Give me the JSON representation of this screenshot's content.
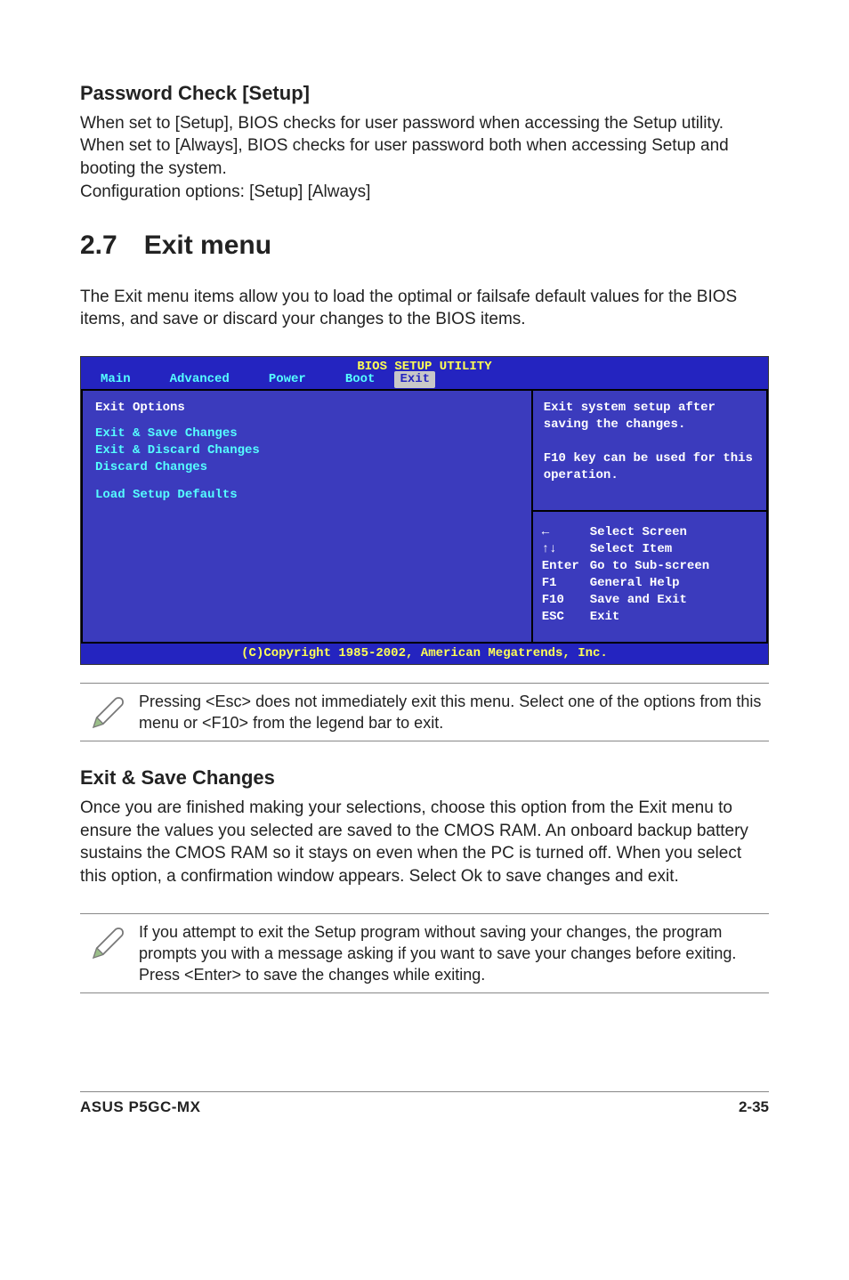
{
  "password_check": {
    "heading": "Password Check [Setup]",
    "body": "When set to [Setup], BIOS checks for user password when accessing the Setup utility. When set to [Always], BIOS checks for user password both when accessing Setup and booting the system.\nConfiguration options: [Setup] [Always]"
  },
  "section": {
    "num_title": "2.7 Exit menu",
    "intro": "The Exit menu items allow you to load the optimal or failsafe default values for the BIOS items, and save or discard your changes to the BIOS items."
  },
  "bios": {
    "title": "BIOS SETUP UTILITY",
    "tabs": {
      "main": "Main",
      "advanced": "Advanced",
      "power": "Power",
      "boot": "Boot",
      "exit": "Exit"
    },
    "left": {
      "label": "Exit Options",
      "opt1": "Exit & Save Changes",
      "opt2": "Exit & Discard Changes",
      "opt3": "Discard Changes",
      "opt4": "Load Setup Defaults"
    },
    "right_help": "Exit system setup after saving the changes.\n\nF10 key can be used for this operation.",
    "nav": {
      "k1": "←",
      "v1": "Select Screen",
      "k2": "↑↓",
      "v2": "Select Item",
      "k3": "Enter",
      "v3": "Go to Sub-screen",
      "k4": "F1",
      "v4": "General Help",
      "k5": "F10",
      "v5": "Save and Exit",
      "k6": "ESC",
      "v6": "Exit"
    },
    "footer": "(C)Copyright 1985-2002, American Megatrends, Inc."
  },
  "note1": "Pressing <Esc> does not immediately exit this menu. Select one of the options from this menu or <F10> from the legend bar to exit.",
  "exit_save": {
    "heading": "Exit & Save Changes",
    "body": "Once you are finished making your selections, choose this option from the Exit menu to ensure the values you selected are saved to the CMOS RAM. An onboard backup battery sustains the CMOS RAM so it stays on even when the PC is turned off. When you select this option, a confirmation window appears. Select Ok to save changes and exit."
  },
  "note2": " If you attempt to exit the Setup program without saving your changes, the program prompts you with a message asking if you want to save your changes before exiting. Press <Enter>  to save the  changes while exiting.",
  "footer": {
    "left": "ASUS P5GC-MX",
    "right": "2-35"
  }
}
